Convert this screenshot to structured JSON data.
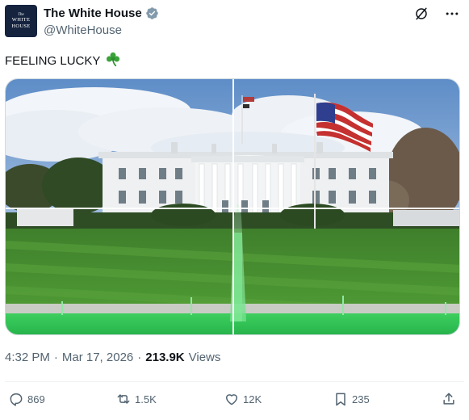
{
  "account": {
    "display_name": "The White House",
    "handle": "@WhiteHouse",
    "avatar_text": [
      "The",
      "WHITE",
      "HOUSE"
    ]
  },
  "tweet": {
    "text": "FEELING LUCKY",
    "emoji": "🍀"
  },
  "meta": {
    "time": "4:32 PM",
    "separator": "·",
    "date": "Mar 17, 2026",
    "views_count": "213.9K",
    "views_label": "Views"
  },
  "actions": {
    "replies": "869",
    "reposts": "1.5K",
    "likes": "12K",
    "bookmarks": "235"
  },
  "icons": {
    "verified": "verified-badge-icon",
    "grok": "grok-icon",
    "more": "more-icon",
    "reply": "reply-icon",
    "repost": "repost-icon",
    "like": "like-icon",
    "bookmark": "bookmark-icon",
    "share": "share-icon"
  },
  "colors": {
    "verified": "#829aab",
    "text_primary": "#0f1419",
    "text_secondary": "#536471",
    "fountain_water": "#39d65a"
  }
}
